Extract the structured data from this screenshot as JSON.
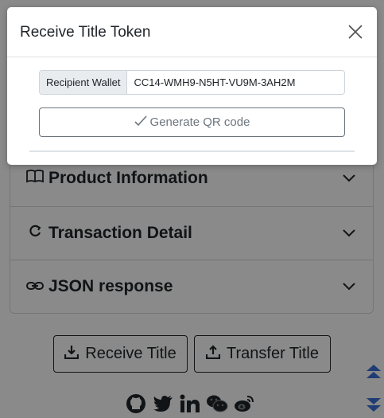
{
  "modal": {
    "title": "Receive Title Token",
    "recipient_label": "Recipient Wallet",
    "recipient_value": "CC14-WMH9-N5HT-VU9M-3AH2M",
    "generate_label": "Generate QR code"
  },
  "accordion": {
    "items": [
      {
        "label": "Product Information",
        "icon": "book-icon"
      },
      {
        "label": "Transaction Detail",
        "icon": "refresh-icon"
      },
      {
        "label": "JSON response",
        "icon": "link-icon"
      }
    ]
  },
  "actions": {
    "receive_label": "Receive Title",
    "transfer_label": "Transfer Title"
  },
  "social": [
    "github-icon",
    "twitter-icon",
    "linkedin-icon",
    "wechat-icon",
    "weibo-icon"
  ]
}
